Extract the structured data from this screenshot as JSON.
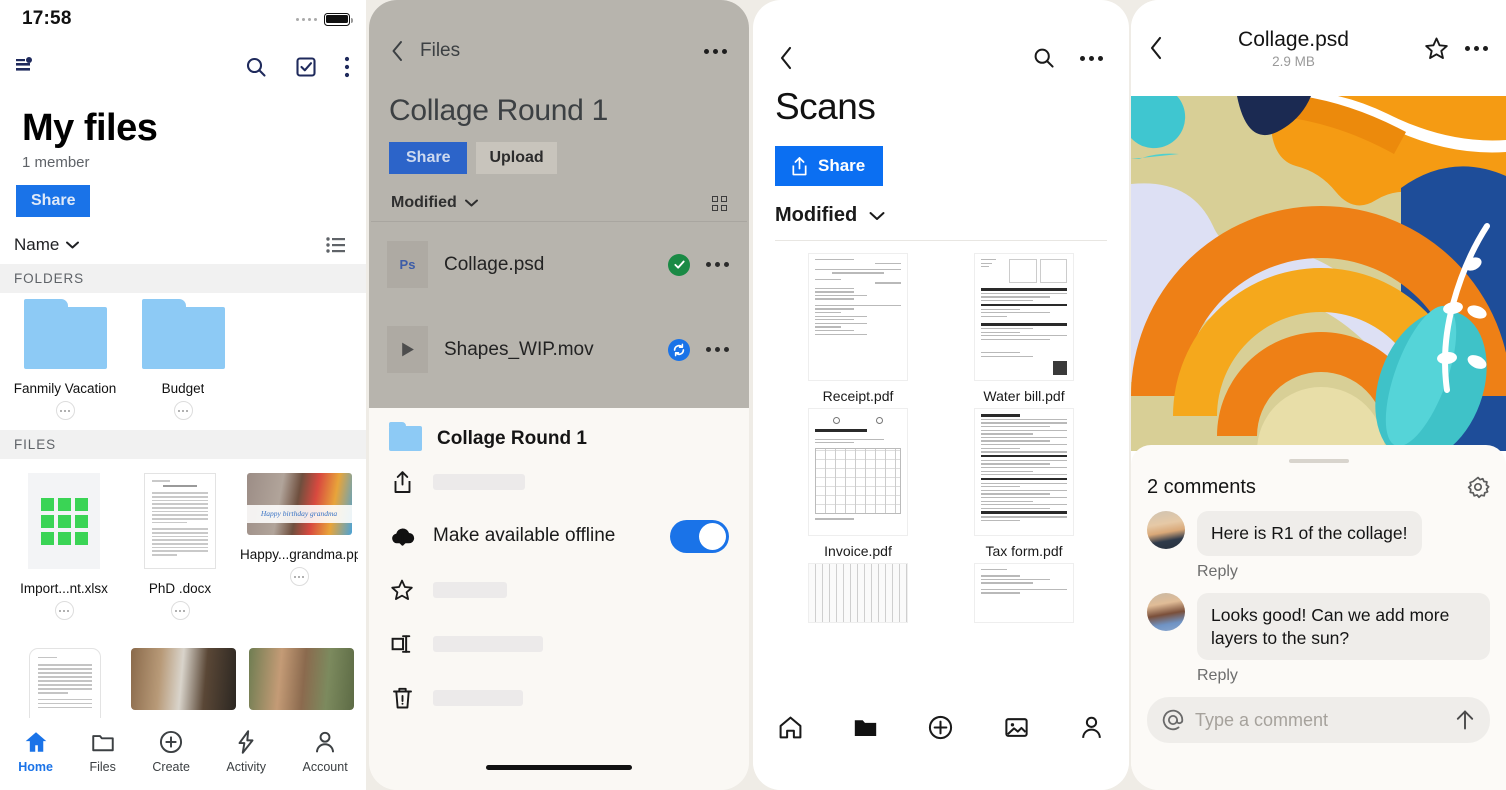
{
  "panel1": {
    "status": {
      "time": "17:58",
      "signal_icon": "signal-dots-icon",
      "battery_icon": "battery-icon"
    },
    "topbar": {
      "menu_icon": "sort-menu-icon",
      "search_icon": "search-icon",
      "select_icon": "checkbox-select-icon",
      "overflow_icon": "more-vertical-icon"
    },
    "title": "My files",
    "subtitle": "1 member",
    "share_label": "Share",
    "sort": {
      "label": "Name",
      "chevron_icon": "chevron-down-icon",
      "view_icon": "list-view-icon"
    },
    "sections": [
      {
        "header": "FOLDERS",
        "items": [
          {
            "name": "Fanmily Vacation",
            "kind": "folder"
          },
          {
            "name": "Budget",
            "kind": "folder"
          }
        ]
      },
      {
        "header": "FILES",
        "items": [
          {
            "name": "Import...nt.xlsx",
            "kind": "xlsx"
          },
          {
            "name": "PhD .docx",
            "kind": "docx"
          },
          {
            "name": "Happy...grandma.pptx",
            "kind": "pptx",
            "thumb_text": "Happy birthday grandma"
          }
        ]
      }
    ],
    "bottom_nav": [
      {
        "label": "Home",
        "icon": "home-icon",
        "active": true
      },
      {
        "label": "Files",
        "icon": "folder-icon",
        "active": false
      },
      {
        "label": "Create",
        "icon": "plus-circle-icon",
        "active": false
      },
      {
        "label": "Activity",
        "icon": "bolt-icon",
        "active": false
      },
      {
        "label": "Account",
        "icon": "person-icon",
        "active": false
      }
    ]
  },
  "panel2": {
    "topbar": {
      "back_icon": "chevron-left-icon",
      "back_label": "Files",
      "overflow_icon": "more-horizontal-icon"
    },
    "title": "Collage Round 1",
    "share_label": "Share",
    "upload_label": "Upload",
    "sort": {
      "label": "Modified",
      "chevron_icon": "chevron-down-icon",
      "view_icon": "grid-view-icon"
    },
    "files": [
      {
        "name": "Collage.psd",
        "icon_label": "Ps",
        "status": "synced",
        "status_icon": "check-circle-icon"
      },
      {
        "name": "Shapes_WIP.mov",
        "icon_label": "play",
        "status": "syncing",
        "status_icon": "sync-circle-icon"
      }
    ],
    "sheet": {
      "title": "Collage Round 1",
      "rows": [
        {
          "icon": "share-upload-icon",
          "label": "",
          "placeholder_width": 92
        },
        {
          "icon": "cloud-download-icon",
          "label": "Make available offline",
          "toggle": true,
          "toggle_on": true
        },
        {
          "icon": "star-icon",
          "label": "",
          "placeholder_width": 74
        },
        {
          "icon": "rename-icon",
          "label": "",
          "placeholder_width": 110
        },
        {
          "icon": "trash-icon",
          "label": "",
          "placeholder_width": 90
        }
      ]
    }
  },
  "panel3": {
    "topbar": {
      "back_icon": "chevron-left-icon",
      "search_icon": "search-icon",
      "overflow_icon": "more-horizontal-icon"
    },
    "title": "Scans",
    "share_label": "Share",
    "share_icon": "share-upload-icon",
    "sort": {
      "label": "Modified",
      "chevron_icon": "chevron-down-icon"
    },
    "files": [
      {
        "name": "Receipt.pdf",
        "kind": "receipt"
      },
      {
        "name": "Water bill.pdf",
        "kind": "bill"
      },
      {
        "name": "Invoice.pdf",
        "kind": "invoice"
      },
      {
        "name": "Tax form.pdf",
        "kind": "taxform"
      },
      {
        "name": "",
        "kind": "spreadsheet"
      },
      {
        "name": "",
        "kind": "handwritten"
      }
    ],
    "bottom_nav": [
      {
        "icon": "home-icon",
        "active": false
      },
      {
        "icon": "folder-icon",
        "active": true
      },
      {
        "icon": "plus-circle-icon",
        "active": false
      },
      {
        "icon": "photo-icon",
        "active": false
      },
      {
        "icon": "person-icon",
        "active": false
      }
    ]
  },
  "panel4": {
    "topbar": {
      "back_icon": "chevron-left-icon",
      "title": "Collage.psd",
      "size": "2.9 MB",
      "star_icon": "star-icon",
      "overflow_icon": "more-horizontal-icon"
    },
    "comments": {
      "count_label": "2 comments",
      "settings_icon": "gear-icon",
      "items": [
        {
          "text": "Here is R1 of the collage!",
          "reply_label": "Reply",
          "avatar": "avatar-1"
        },
        {
          "text": "Looks good! Can we add more layers to the sun?",
          "reply_label": "Reply",
          "avatar": "avatar-2"
        }
      ],
      "input": {
        "mention_icon": "at-icon",
        "placeholder": "Type a comment",
        "send_icon": "arrow-up-icon"
      }
    }
  },
  "colors": {
    "brand_blue": "#1a73e8",
    "share_blue_p3": "#0b6ff2",
    "share_blue_p2": "#2c64c9",
    "folder_blue": "#8dcaf5",
    "sync_ok_green": "#1a8a45",
    "page_bg": "#efece6",
    "dim_overlay": "#b7b4ad"
  }
}
